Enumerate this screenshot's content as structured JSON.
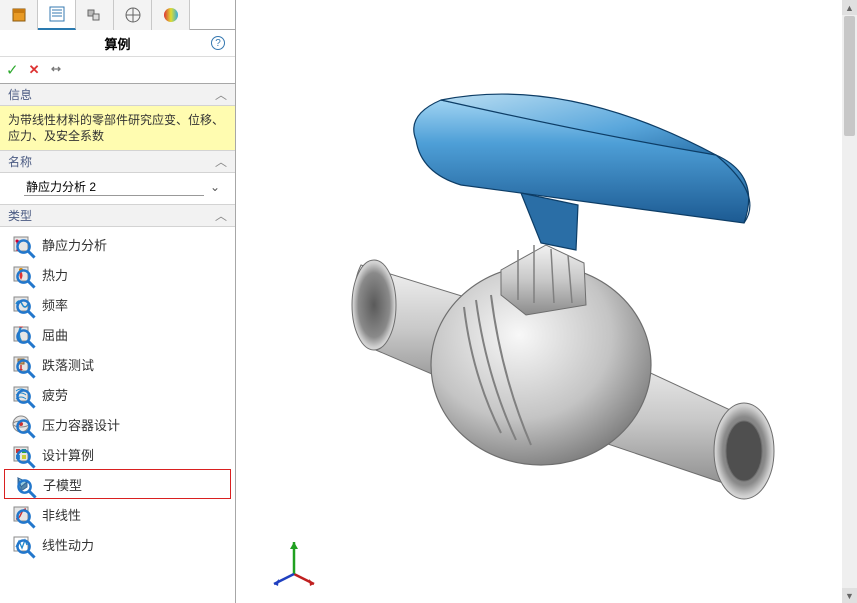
{
  "panel": {
    "title": "算例",
    "help": "?",
    "cmds": {
      "ok": "✓",
      "cancel": "✕",
      "pin": "⇹"
    }
  },
  "sections": {
    "info_hdr": "信息",
    "info_body": "为带线性材料的零部件研究应变、位移、应力、及安全系数",
    "name_hdr": "名称",
    "name_value": "静应力分析 2",
    "type_hdr": "类型"
  },
  "types": [
    {
      "key": "static",
      "label": "静应力分析",
      "icon": "static"
    },
    {
      "key": "thermal",
      "label": "热力",
      "icon": "thermal"
    },
    {
      "key": "freq",
      "label": "频率",
      "icon": "freq"
    },
    {
      "key": "buckling",
      "label": "屈曲",
      "icon": "buckling"
    },
    {
      "key": "drop",
      "label": "跌落测试",
      "icon": "drop"
    },
    {
      "key": "fatigue",
      "label": "疲劳",
      "icon": "fatigue"
    },
    {
      "key": "pressure",
      "label": "压力容器设计",
      "icon": "pressure"
    },
    {
      "key": "design",
      "label": "设计算例",
      "icon": "design"
    },
    {
      "key": "submodel",
      "label": "子模型",
      "icon": "submodel",
      "highlight": true
    },
    {
      "key": "nonlinear",
      "label": "非线性",
      "icon": "nonlinear"
    },
    {
      "key": "lineardyn",
      "label": "线性动力",
      "icon": "lineardyn"
    }
  ],
  "colors": {
    "handle_top": "#6fb8e8",
    "handle_side": "#2b6ea8",
    "body_light": "#e0e0e0",
    "body_mid": "#b8b8b8",
    "body_dark": "#8a8a8a",
    "highlight_red": "#d92020"
  },
  "triad": {
    "x": "#c02020",
    "y": "#20a020",
    "z": "#2040c0"
  }
}
